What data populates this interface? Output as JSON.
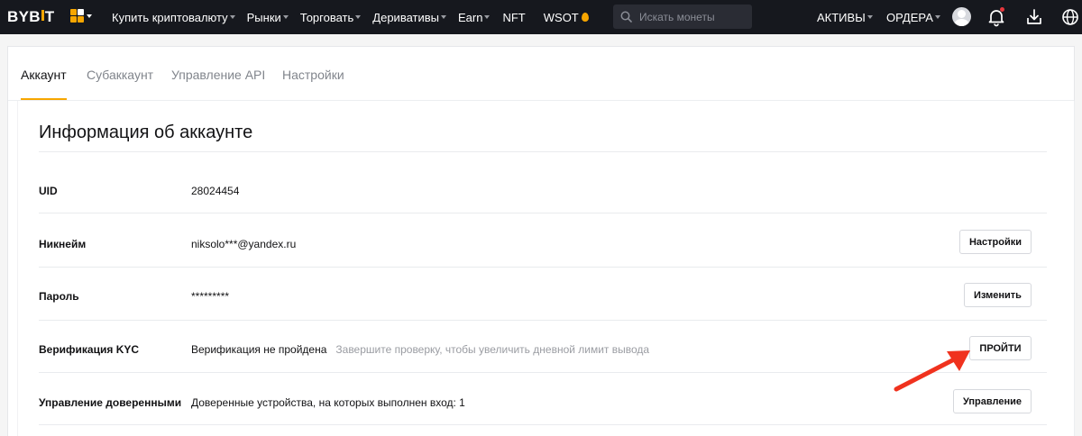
{
  "brand": {
    "logo_left": "BYB",
    "logo_right": "T",
    "accent_color": "#f7a600",
    "nav_bg": "#16181e"
  },
  "nav": {
    "links": [
      {
        "label": "Купить криптовалюту",
        "dropdown": true
      },
      {
        "label": "Рынки",
        "dropdown": true
      },
      {
        "label": "Торговать",
        "dropdown": true
      },
      {
        "label": "Деривативы",
        "dropdown": true
      },
      {
        "label": "Earn",
        "dropdown": true
      },
      {
        "label": "NFT",
        "dropdown": false
      },
      {
        "label": "WSOT",
        "dropdown": false
      }
    ],
    "search_placeholder": "Искать монеты",
    "assets_label": "АКТИВЫ",
    "orders_label": "ОРДЕРА",
    "icons": [
      "apps-grid-icon",
      "search-icon",
      "user-avatar-icon",
      "bell-icon",
      "download-icon",
      "globe-icon"
    ]
  },
  "tabs": [
    {
      "label": "Аккаунт",
      "active": true
    },
    {
      "label": "Субаккаунт",
      "active": false
    },
    {
      "label": "Управление API",
      "active": false
    },
    {
      "label": "Настройки",
      "active": false
    }
  ],
  "account": {
    "title": "Информация об аккаунте",
    "rows": [
      {
        "label": "UID",
        "value": "28024454",
        "hint": "",
        "button": ""
      },
      {
        "label": "Никнейм",
        "value": "niksolo***@yandex.ru",
        "hint": "",
        "button": "Настройки"
      },
      {
        "label": "Пароль",
        "value": "*********",
        "hint": "",
        "button": "Изменить"
      },
      {
        "label": "Верификация KYC",
        "value": "Верификация не пройдена",
        "hint": "Завершите проверку, чтобы увеличить дневной лимит вывода",
        "button": "ПРОЙТИ"
      },
      {
        "label": "Управление доверенными",
        "value": "Доверенные устройства, на которых выполнен вход: 1",
        "hint": "",
        "button": "Управление"
      }
    ]
  },
  "annotation": {
    "arrow_color": "#f0321e",
    "points_to": "ПРОЙТИ"
  }
}
